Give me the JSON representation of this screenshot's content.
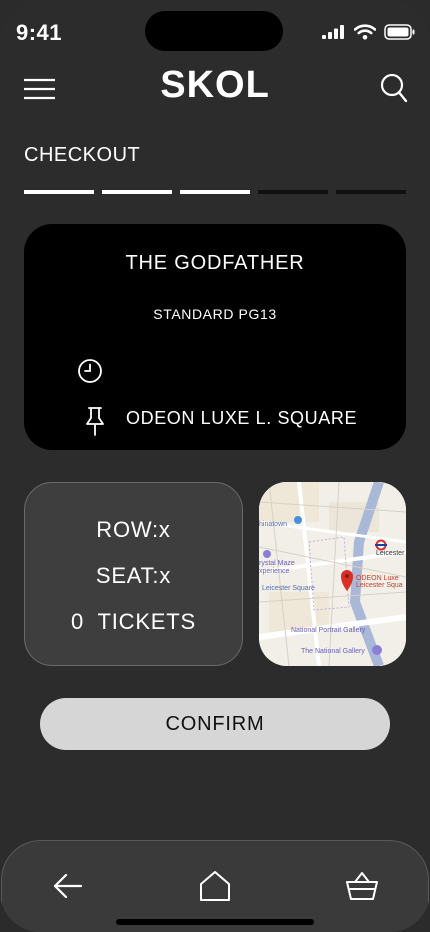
{
  "status_bar": {
    "time": "9:41"
  },
  "header": {
    "brand": "SKOL"
  },
  "checkout": {
    "title": "CHECKOUT",
    "progress": {
      "completed_steps": 3,
      "total_steps": 5
    }
  },
  "movie": {
    "title": "THE GODFATHER",
    "format": "STANDARD PG13",
    "showtime": "",
    "venue": "ODEON LUXE L. SQUARE"
  },
  "seat": {
    "row": "ROW:x",
    "seat": "SEAT:x",
    "tickets": "0  TICKETS"
  },
  "map": {
    "labels": {
      "chinatown": "hinatown",
      "leicester": "Leicester",
      "crystal_maze": "rystal Maze",
      "experience": "xperience",
      "leicester_square": "Leicester Square",
      "odeon_1": "ODEON Luxe",
      "odeon_2": "Leicester Squa",
      "national_portrait": "National Portrait Gallery",
      "national_gallery": "The National Gallery"
    }
  },
  "actions": {
    "confirm_label": "CONFIRM"
  },
  "icons": {
    "menu": "menu-icon",
    "search": "search-icon",
    "clock": "clock-icon",
    "pin": "pushpin-icon",
    "back": "arrow-left-icon",
    "home": "home-icon",
    "basket": "basket-icon"
  },
  "colors": {
    "background": "#2c2c2c",
    "card": "#000000",
    "seat_card": "#3e3e3e",
    "button": "#d6d6d6",
    "map_pin": "#d93025"
  }
}
